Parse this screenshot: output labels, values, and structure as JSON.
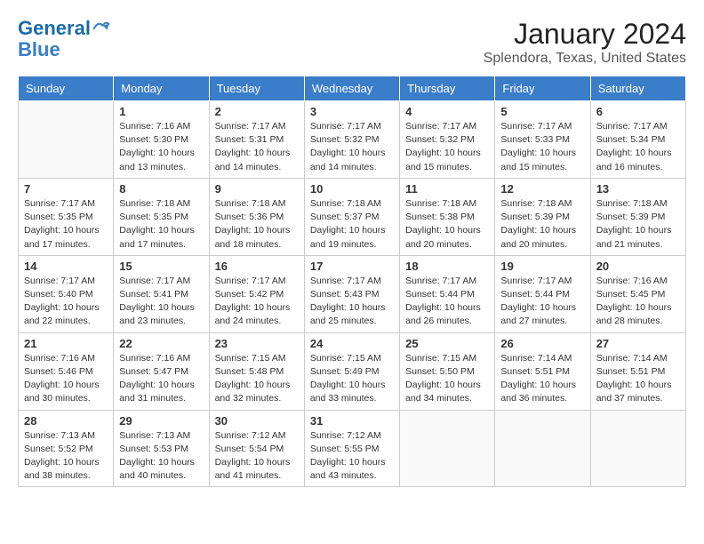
{
  "logo": {
    "line1": "General",
    "line2": "Blue"
  },
  "title": "January 2024",
  "subtitle": "Splendora, Texas, United States",
  "weekdays": [
    "Sunday",
    "Monday",
    "Tuesday",
    "Wednesday",
    "Thursday",
    "Friday",
    "Saturday"
  ],
  "weeks": [
    [
      {
        "day": "",
        "sunrise": "",
        "sunset": "",
        "daylight": ""
      },
      {
        "day": "1",
        "sunrise": "7:16 AM",
        "sunset": "5:30 PM",
        "daylight": "10 hours and 13 minutes."
      },
      {
        "day": "2",
        "sunrise": "7:17 AM",
        "sunset": "5:31 PM",
        "daylight": "10 hours and 14 minutes."
      },
      {
        "day": "3",
        "sunrise": "7:17 AM",
        "sunset": "5:32 PM",
        "daylight": "10 hours and 14 minutes."
      },
      {
        "day": "4",
        "sunrise": "7:17 AM",
        "sunset": "5:32 PM",
        "daylight": "10 hours and 15 minutes."
      },
      {
        "day": "5",
        "sunrise": "7:17 AM",
        "sunset": "5:33 PM",
        "daylight": "10 hours and 15 minutes."
      },
      {
        "day": "6",
        "sunrise": "7:17 AM",
        "sunset": "5:34 PM",
        "daylight": "10 hours and 16 minutes."
      }
    ],
    [
      {
        "day": "7",
        "sunrise": "7:17 AM",
        "sunset": "5:35 PM",
        "daylight": "10 hours and 17 minutes."
      },
      {
        "day": "8",
        "sunrise": "7:18 AM",
        "sunset": "5:35 PM",
        "daylight": "10 hours and 17 minutes."
      },
      {
        "day": "9",
        "sunrise": "7:18 AM",
        "sunset": "5:36 PM",
        "daylight": "10 hours and 18 minutes."
      },
      {
        "day": "10",
        "sunrise": "7:18 AM",
        "sunset": "5:37 PM",
        "daylight": "10 hours and 19 minutes."
      },
      {
        "day": "11",
        "sunrise": "7:18 AM",
        "sunset": "5:38 PM",
        "daylight": "10 hours and 20 minutes."
      },
      {
        "day": "12",
        "sunrise": "7:18 AM",
        "sunset": "5:39 PM",
        "daylight": "10 hours and 20 minutes."
      },
      {
        "day": "13",
        "sunrise": "7:18 AM",
        "sunset": "5:39 PM",
        "daylight": "10 hours and 21 minutes."
      }
    ],
    [
      {
        "day": "14",
        "sunrise": "7:17 AM",
        "sunset": "5:40 PM",
        "daylight": "10 hours and 22 minutes."
      },
      {
        "day": "15",
        "sunrise": "7:17 AM",
        "sunset": "5:41 PM",
        "daylight": "10 hours and 23 minutes."
      },
      {
        "day": "16",
        "sunrise": "7:17 AM",
        "sunset": "5:42 PM",
        "daylight": "10 hours and 24 minutes."
      },
      {
        "day": "17",
        "sunrise": "7:17 AM",
        "sunset": "5:43 PM",
        "daylight": "10 hours and 25 minutes."
      },
      {
        "day": "18",
        "sunrise": "7:17 AM",
        "sunset": "5:44 PM",
        "daylight": "10 hours and 26 minutes."
      },
      {
        "day": "19",
        "sunrise": "7:17 AM",
        "sunset": "5:44 PM",
        "daylight": "10 hours and 27 minutes."
      },
      {
        "day": "20",
        "sunrise": "7:16 AM",
        "sunset": "5:45 PM",
        "daylight": "10 hours and 28 minutes."
      }
    ],
    [
      {
        "day": "21",
        "sunrise": "7:16 AM",
        "sunset": "5:46 PM",
        "daylight": "10 hours and 30 minutes."
      },
      {
        "day": "22",
        "sunrise": "7:16 AM",
        "sunset": "5:47 PM",
        "daylight": "10 hours and 31 minutes."
      },
      {
        "day": "23",
        "sunrise": "7:15 AM",
        "sunset": "5:48 PM",
        "daylight": "10 hours and 32 minutes."
      },
      {
        "day": "24",
        "sunrise": "7:15 AM",
        "sunset": "5:49 PM",
        "daylight": "10 hours and 33 minutes."
      },
      {
        "day": "25",
        "sunrise": "7:15 AM",
        "sunset": "5:50 PM",
        "daylight": "10 hours and 34 minutes."
      },
      {
        "day": "26",
        "sunrise": "7:14 AM",
        "sunset": "5:51 PM",
        "daylight": "10 hours and 36 minutes."
      },
      {
        "day": "27",
        "sunrise": "7:14 AM",
        "sunset": "5:51 PM",
        "daylight": "10 hours and 37 minutes."
      }
    ],
    [
      {
        "day": "28",
        "sunrise": "7:13 AM",
        "sunset": "5:52 PM",
        "daylight": "10 hours and 38 minutes."
      },
      {
        "day": "29",
        "sunrise": "7:13 AM",
        "sunset": "5:53 PM",
        "daylight": "10 hours and 40 minutes."
      },
      {
        "day": "30",
        "sunrise": "7:12 AM",
        "sunset": "5:54 PM",
        "daylight": "10 hours and 41 minutes."
      },
      {
        "day": "31",
        "sunrise": "7:12 AM",
        "sunset": "5:55 PM",
        "daylight": "10 hours and 43 minutes."
      },
      {
        "day": "",
        "sunrise": "",
        "sunset": "",
        "daylight": ""
      },
      {
        "day": "",
        "sunrise": "",
        "sunset": "",
        "daylight": ""
      },
      {
        "day": "",
        "sunrise": "",
        "sunset": "",
        "daylight": ""
      }
    ]
  ],
  "labels": {
    "sunrise": "Sunrise:",
    "sunset": "Sunset:",
    "daylight": "Daylight:"
  }
}
